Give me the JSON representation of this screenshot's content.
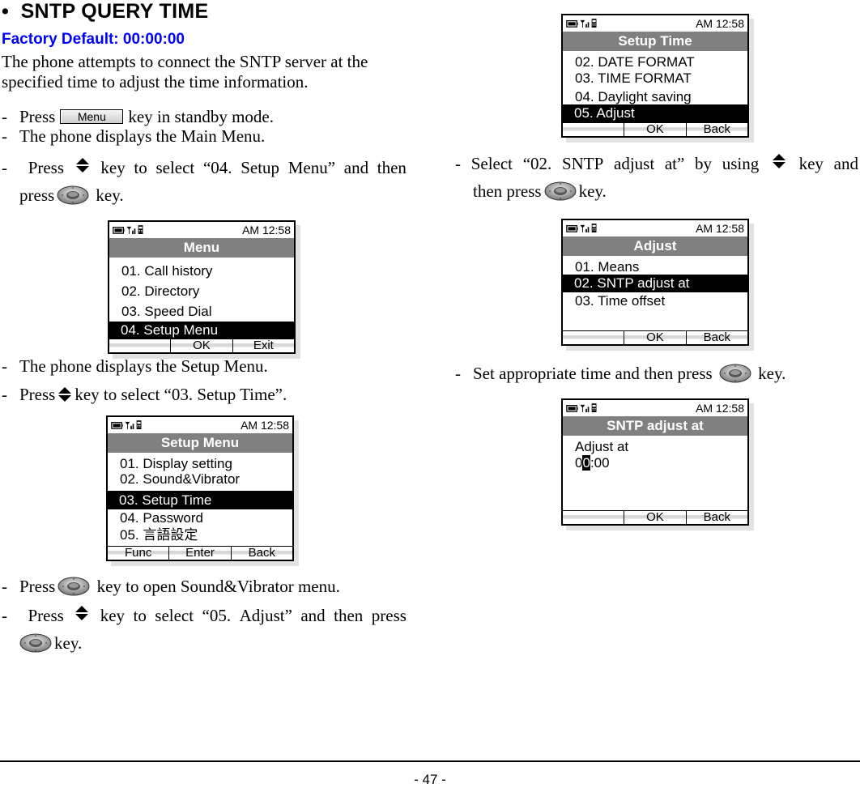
{
  "heading": "SNTP QUERY TIME",
  "bullet": "•",
  "factory_default": "Factory Default: 00:00:00",
  "intro": "The phone attempts to connect the SNTP server at the specified time to adjust the time information.",
  "icons": {
    "menu_key": "Menu",
    "nav_key": "up-down-navigation-key-icon",
    "ok_key": "center-ok-key-icon"
  },
  "steps_left": [
    {
      "dash": "-",
      "pre": "Press",
      "key": "menu",
      "post": "key in standby mode."
    },
    {
      "dash": "-",
      "text": "The phone displays the Main Menu."
    },
    {
      "dash": "-",
      "pre": "Press",
      "key": "nav",
      "post": "key to select “04. Setup Menu” and then",
      "line2_pre": "press",
      "line2_key": "ok",
      "line2_post": "key."
    },
    {
      "dash": "-",
      "text": "The phone displays the Setup Menu."
    },
    {
      "dash": "-",
      "pre": "Press",
      "key": "nav",
      "post": "key to select “03. Setup Time”."
    },
    {
      "dash": "-",
      "pre": "Press",
      "key": "ok",
      "post": "key to open Sound&Vibrator menu."
    },
    {
      "dash": "-",
      "pre": "Press",
      "key": "nav",
      "post": "key to select “05. Adjust” and then press",
      "line2_key": "ok",
      "line2_post": "key."
    }
  ],
  "steps_right": [
    {
      "dash": "-",
      "pre": "Select “02. SNTP adjust at” by using",
      "key": "nav",
      "post": "key and",
      "line2_pre": "then press",
      "line2_key": "ok",
      "line2_post": "key."
    },
    {
      "dash": "-",
      "pre": "Set appropriate time and then press",
      "key": "ok",
      "post": "key."
    }
  ],
  "screens": {
    "menu": {
      "time": "AM 12:58",
      "title": "Menu",
      "items": [
        "01. Call history",
        "02. Directory",
        "03. Speed Dial",
        "04. Setup Menu"
      ],
      "selected": 3,
      "softkeys": [
        "",
        "OK",
        "Exit"
      ]
    },
    "setup_menu": {
      "time": "AM 12:58",
      "title": "Setup Menu",
      "items": [
        "01. Display setting",
        "02. Sound&Vibrator",
        "03. Setup Time",
        "04. Password",
        "05. 言語設定"
      ],
      "selected": 2,
      "softkeys": [
        "Func",
        "Enter",
        "Back"
      ]
    },
    "setup_time": {
      "time": "AM 12:58",
      "title": "Setup Time",
      "items": [
        "02. DATE FORMAT",
        "03. TIME FORMAT",
        "04. Daylight saving",
        "05. Adjust"
      ],
      "selected": 3,
      "softkeys": [
        "",
        "OK",
        "Back"
      ]
    },
    "adjust": {
      "time": "AM 12:58",
      "title": "Adjust",
      "items": [
        "01. Means",
        "02. SNTP adjust at",
        "03. Time offset"
      ],
      "selected": 1,
      "softkeys": [
        "",
        "OK",
        "Back"
      ]
    },
    "sntp_adjust_at": {
      "time": "AM 12:58",
      "title": "SNTP adjust at",
      "label": "Adjust at",
      "value_before": "0",
      "value_cursor": "0",
      "value_after": ":00",
      "softkeys": [
        "",
        "OK",
        "Back"
      ]
    }
  },
  "page_number": "- 47 -"
}
